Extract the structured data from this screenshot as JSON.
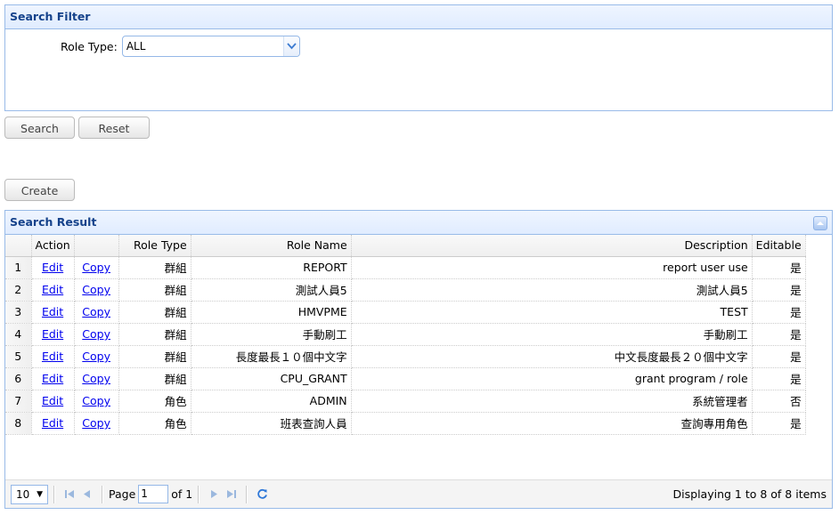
{
  "filter": {
    "title": "Search Filter",
    "role_type_label": "Role Type:",
    "role_type_value": "ALL"
  },
  "buttons": {
    "search": "Search",
    "reset": "Reset",
    "create": "Create"
  },
  "result": {
    "title": "Search Result",
    "columns": {
      "action": "Action",
      "role_type": "Role Type",
      "role_name": "Role Name",
      "description": "Description",
      "editable": "Editable"
    },
    "rows": [
      {
        "num": "1",
        "edit": "Edit",
        "copy": "Copy",
        "role_type": "群組",
        "role_name": "REPORT",
        "description": "report user use",
        "editable": "是"
      },
      {
        "num": "2",
        "edit": "Edit",
        "copy": "Copy",
        "role_type": "群組",
        "role_name": "測試人員5",
        "description": "測試人員5",
        "editable": "是"
      },
      {
        "num": "3",
        "edit": "Edit",
        "copy": "Copy",
        "role_type": "群組",
        "role_name": "HMVPME",
        "description": "TEST",
        "editable": "是"
      },
      {
        "num": "4",
        "edit": "Edit",
        "copy": "Copy",
        "role_type": "群組",
        "role_name": "手動刷工",
        "description": "手動刷工",
        "editable": "是"
      },
      {
        "num": "5",
        "edit": "Edit",
        "copy": "Copy",
        "role_type": "群組",
        "role_name": "長度最長１０個中文字",
        "description": "中文長度最長２０個中文字",
        "editable": "是"
      },
      {
        "num": "6",
        "edit": "Edit",
        "copy": "Copy",
        "role_type": "群組",
        "role_name": "CPU_GRANT",
        "description": "grant program / role",
        "editable": "是"
      },
      {
        "num": "7",
        "edit": "Edit",
        "copy": "Copy",
        "role_type": "角色",
        "role_name": "ADMIN",
        "description": "系統管理者",
        "editable": "否"
      },
      {
        "num": "8",
        "edit": "Edit",
        "copy": "Copy",
        "role_type": "角色",
        "role_name": "班表查詢人員",
        "description": "查詢專用角色",
        "editable": "是"
      }
    ],
    "pager": {
      "page_size": "10",
      "page_label": "Page",
      "page_value": "1",
      "of_label": "of 1",
      "info": "Displaying 1 to 8 of 8 items"
    }
  },
  "colors": {
    "panel_border": "#99bbe8",
    "header_text": "#15428b",
    "link": "#0000ee"
  },
  "icons": [
    "chevron-down-icon",
    "collapse-icon",
    "first-page-icon",
    "prev-page-icon",
    "next-page-icon",
    "last-page-icon",
    "refresh-icon"
  ]
}
